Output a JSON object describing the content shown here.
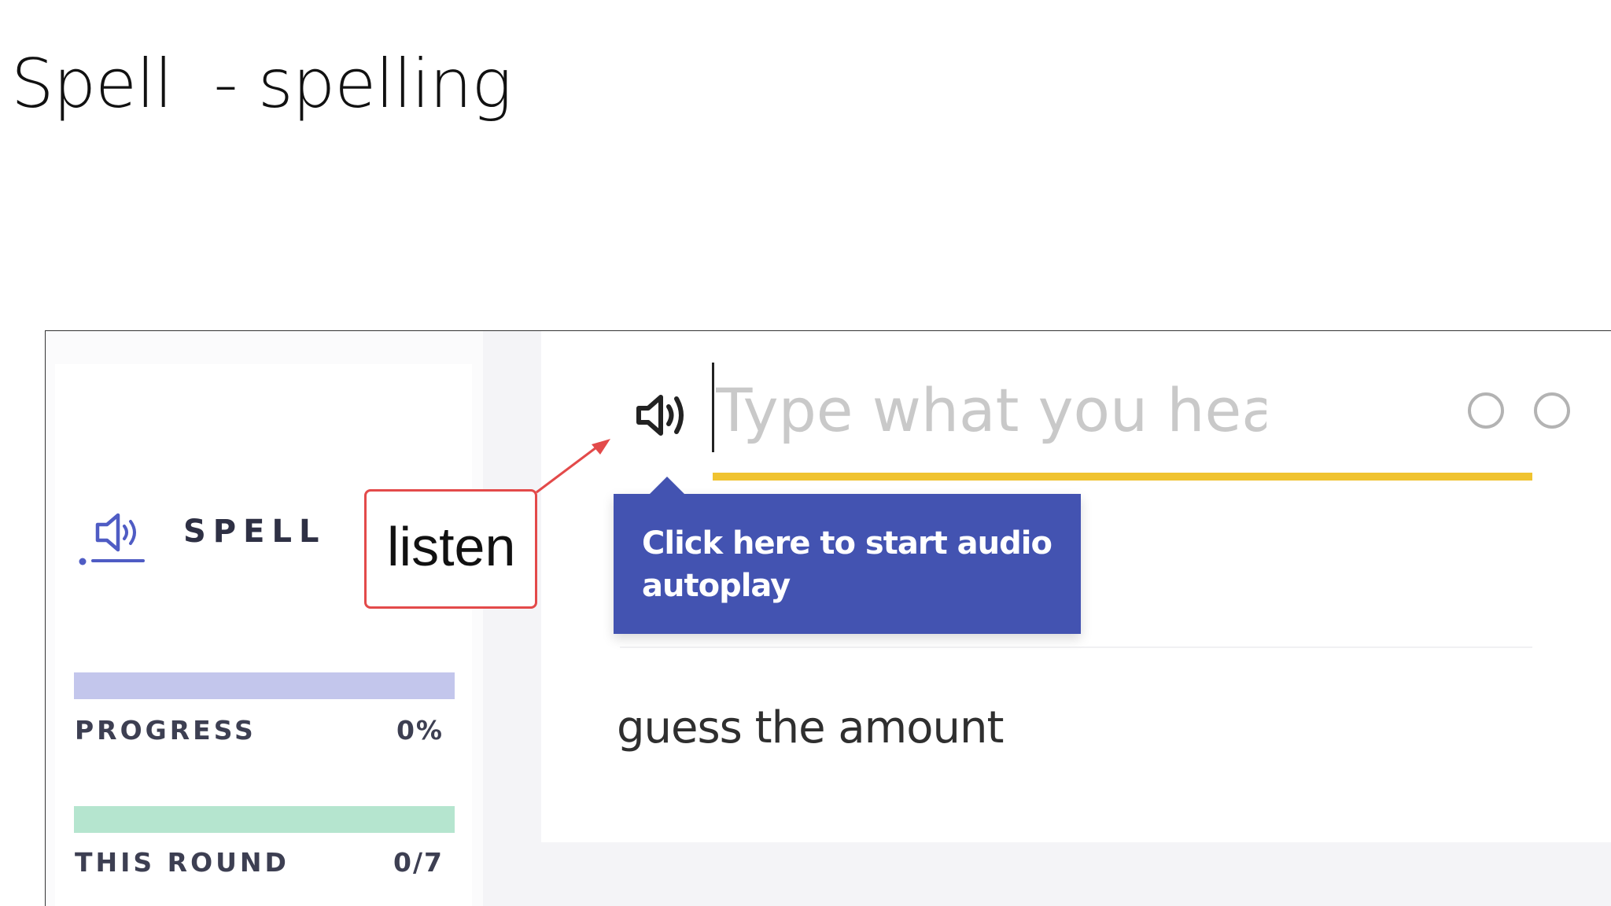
{
  "slide": {
    "title": "Spell  - spelling"
  },
  "sidebar": {
    "mode_icon": "speaker-icon",
    "mode_label": "SPELL",
    "progress": {
      "label": "PROGRESS",
      "value": "0%",
      "fraction": 0
    },
    "round": {
      "label": "THIS ROUND",
      "value": "0/7",
      "fraction": 0
    }
  },
  "main": {
    "speaker_icon": "speaker-icon",
    "input": {
      "placeholder": "Type what you hear",
      "value": ""
    },
    "hint": "guess the amount",
    "tooltip": "Click here to start audio autoplay"
  },
  "annotation": {
    "callout": "listen",
    "color": "#e34a4a"
  },
  "colors": {
    "accent_blue": "#4353b1",
    "underline_yellow": "#f0c330",
    "progress_bar": "#c3c6ec",
    "round_bar": "#b5e5cf"
  }
}
